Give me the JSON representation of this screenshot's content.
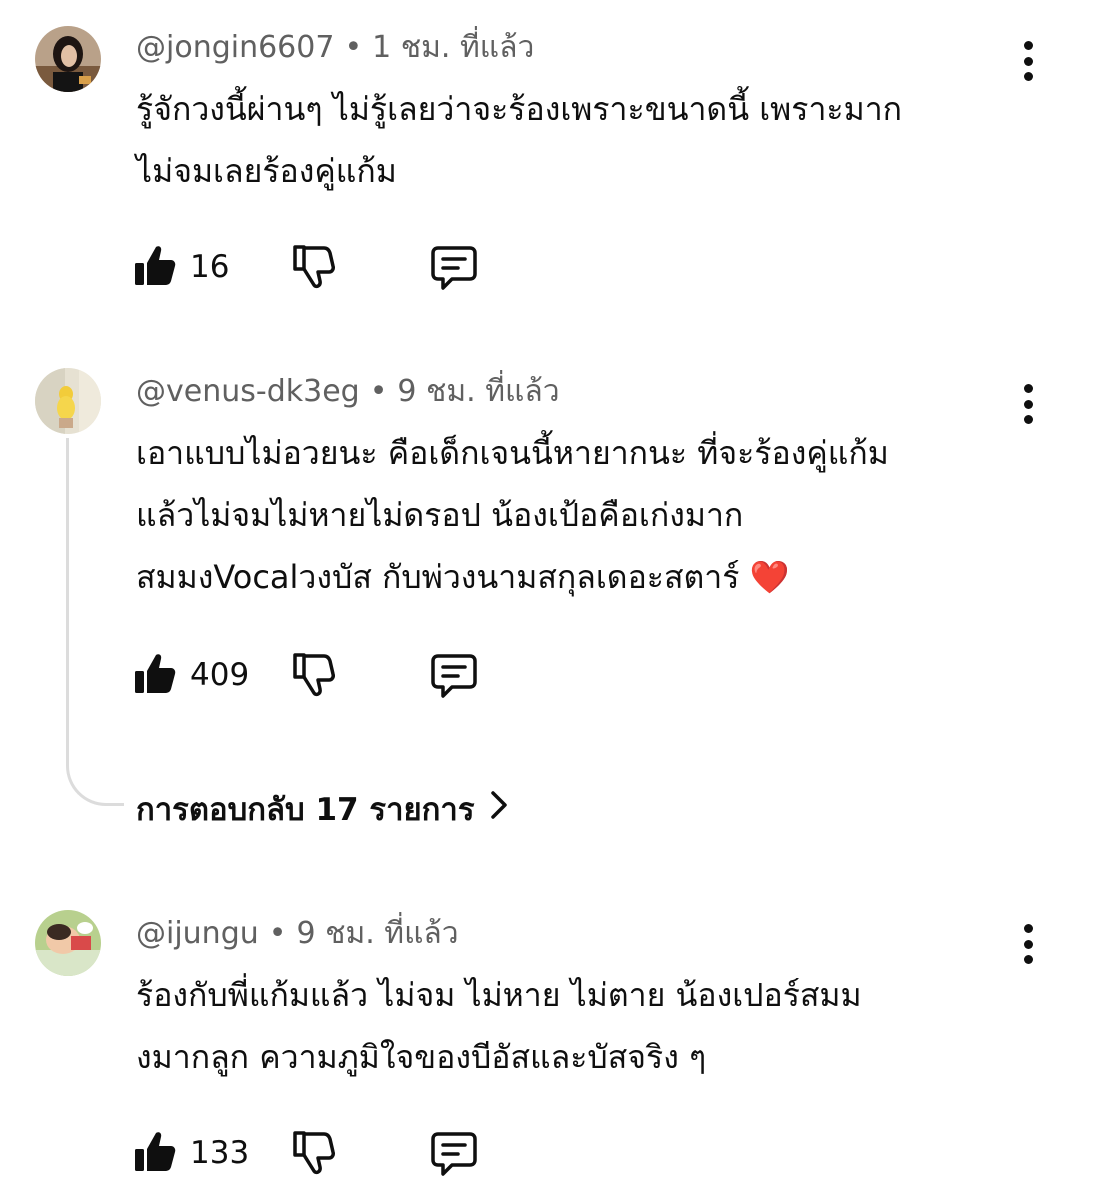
{
  "comments": [
    {
      "handle": "@jongin6607",
      "time": "1 ชม. ที่แล้ว",
      "lines": [
        "รู้จักวงนี้ผ่านๆ ไม่รู้เลยว่าจะร้องเพราะขนาดนี้ เพราะมาก",
        "ไม่จมเลยร้องคู่แก้ม"
      ],
      "likes": "16"
    },
    {
      "handle": "@venus-dk3eg",
      "time": "9 ชม. ที่แล้ว",
      "lines": [
        "เอาแบบไม่อวยนะ คือเด็กเจนนี้หายากนะ ที่จะร้องคู่แก้ม",
        "แล้วไม่จมไม่หายไม่ดรอป น้องเป้อคือเก่งมาก",
        "สมมงVocalวงบัส กับพ่วงนามสกุลเดอะสตาร์ ❤️"
      ],
      "likes": "409",
      "replies_label": "การตอบกลับ 17 รายการ"
    },
    {
      "handle": "@ijungu",
      "time": "9 ชม. ที่แล้ว",
      "lines": [
        "ร้องกับพี่แก้มแล้ว ไม่จม ไม่หาย ไม่ตาย น้องเปอร์สมม",
        "งมากลูก ความภูมิใจของบีอัสและบัสจริง ๆ"
      ],
      "likes": "133"
    }
  ],
  "separator": "•",
  "icons": {
    "like": "thumbs-up-filled-icon",
    "dislike": "thumbs-down-outline-icon",
    "reply": "comment-bubble-icon",
    "more": "vertical-ellipsis-icon",
    "chevron": "chevron-right-icon"
  }
}
